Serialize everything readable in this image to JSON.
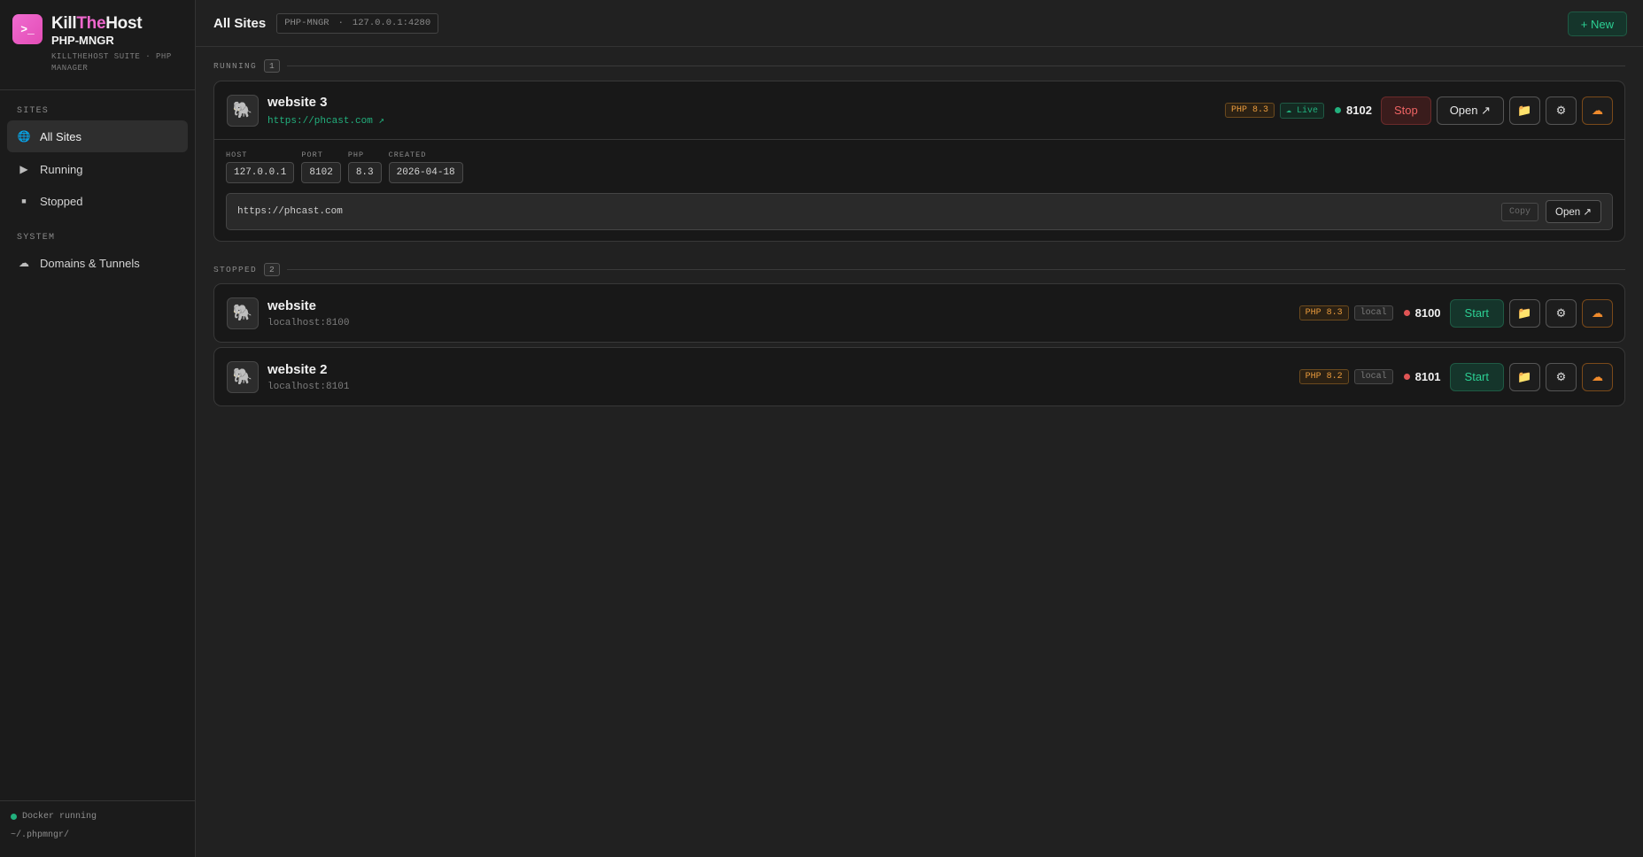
{
  "brand": {
    "name_part1": "Kill",
    "name_part2": "The",
    "name_part3": "Host",
    "product": "PHP-MNGR",
    "description": "KILLTHEHOST SUITE · PHP MANAGER",
    "logo_glyph": ">_"
  },
  "sidebar": {
    "sections": [
      {
        "title": "SITES",
        "items": [
          {
            "label": "All Sites",
            "icon": "globe-icon",
            "active": true
          },
          {
            "label": "Running",
            "icon": "play-icon"
          },
          {
            "label": "Stopped",
            "icon": "stop-icon"
          }
        ]
      },
      {
        "title": "SYSTEM",
        "items": [
          {
            "label": "Domains & Tunnels",
            "icon": "cloud-icon"
          }
        ]
      }
    ],
    "footer": {
      "docker_status": "Docker running",
      "path": "~/.phpmngr/"
    }
  },
  "topbar": {
    "title": "All Sites",
    "app_label": "PHP-MNGR",
    "separator": "·",
    "address": "127.0.0.1:4280",
    "new_label": "+ New"
  },
  "running": {
    "title": "RUNNING",
    "count": "1",
    "sites": [
      {
        "name": "website 3",
        "url": "https://phcast.com ↗",
        "php": "PHP 8.3",
        "status_badge": "☁ Live",
        "port": "8102",
        "stop_label": "Stop",
        "open_label": "Open ↗",
        "details": {
          "host_label": "HOST",
          "host": "127.0.0.1",
          "port_label": "PORT",
          "port": "8102",
          "php_label": "PHP",
          "php": "8.3",
          "created_label": "CREATED",
          "created": "2026-04-18",
          "url": "https://phcast.com",
          "copy_label": "Copy",
          "open_label": "Open ↗"
        }
      }
    ]
  },
  "stopped": {
    "title": "STOPPED",
    "count": "2",
    "sites": [
      {
        "name": "website",
        "url": "localhost:8100",
        "php": "PHP 8.3",
        "status_badge": "local",
        "port": "8100",
        "start_label": "Start"
      },
      {
        "name": "website 2",
        "url": "localhost:8101",
        "php": "PHP 8.2",
        "status_badge": "local",
        "port": "8101",
        "start_label": "Start"
      }
    ]
  },
  "icons": {
    "site": "🐘",
    "folder": "📁",
    "settings": "⚙",
    "cloud": "☁"
  },
  "colors": {
    "accent_green": "#22b07d",
    "accent_pink": "#ee67cd",
    "stop_red": "#ef6464",
    "php_orange": "#e89a3c"
  }
}
